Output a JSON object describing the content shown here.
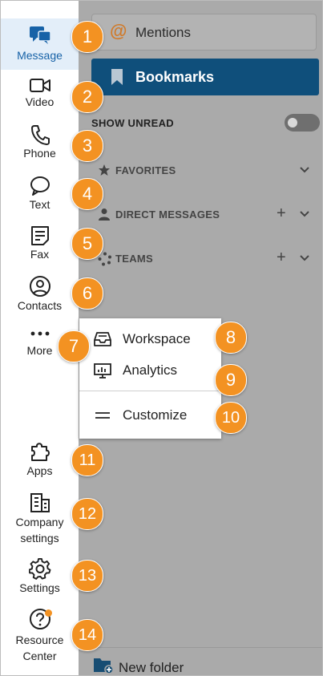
{
  "nav": {
    "message": "Message",
    "video": "Video",
    "phone": "Phone",
    "text": "Text",
    "fax": "Fax",
    "contacts": "Contacts",
    "more": "More",
    "apps": "Apps",
    "company_settings_line1": "Company",
    "company_settings_line2": "settings",
    "settings": "Settings",
    "resource_center_line1": "Resource",
    "resource_center_line2": "Center"
  },
  "panel": {
    "mentions": "Mentions",
    "bookmarks": "Bookmarks",
    "show_unread": "SHOW UNREAD",
    "show_unread_on": false,
    "favorites": "FAVORITES",
    "direct_messages": "DIRECT MESSAGES",
    "teams": "TEAMS",
    "new_folder": "New folder"
  },
  "more_menu": {
    "workspace": "Workspace",
    "analytics": "Analytics",
    "customize": "Customize"
  },
  "callouts": [
    "1",
    "2",
    "3",
    "4",
    "5",
    "6",
    "7",
    "8",
    "9",
    "10",
    "11",
    "12",
    "13",
    "14"
  ],
  "colors": {
    "active_nav": "#1762a7",
    "active_nav_bg": "#e3eef9",
    "bookmarks_bg": "#0f4f7b",
    "callout": "#f39222",
    "panel_bg": "#aaaaaa",
    "notification_dot": "#f39222"
  }
}
